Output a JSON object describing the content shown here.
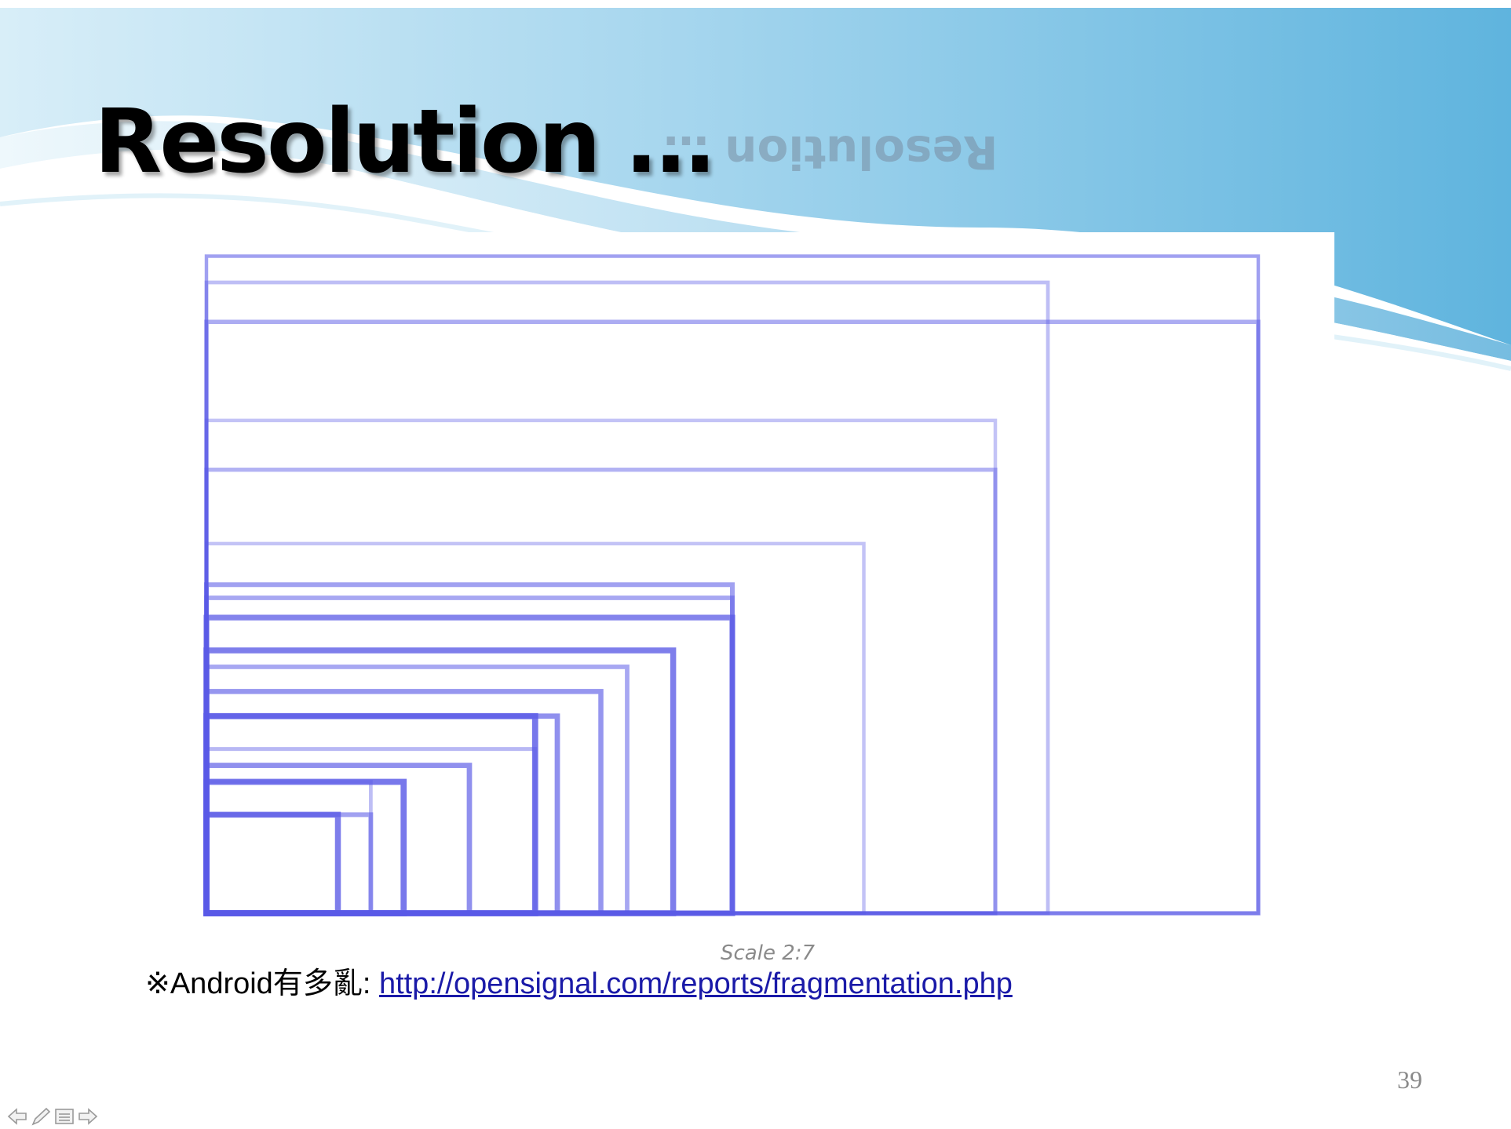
{
  "slide": {
    "title": "Resolution …",
    "title_reflection": "Resolution …",
    "page_number": "39"
  },
  "chart": {
    "scale_label": "Scale 2:7"
  },
  "note": {
    "prefix": "※Android有多亂: ",
    "link_text": "http://opensignal.com/reports/fragmentation.php"
  },
  "nav": {
    "icons": [
      "arrow-left-icon",
      "pen-icon",
      "menu-icon",
      "arrow-right-icon"
    ]
  },
  "colors": {
    "rect_stroke": "#5a5ae6",
    "title_text": "#000000",
    "link": "#1a1aa8",
    "wave_light": "#bfe3f3",
    "wave_dark": "#5cb3dd"
  },
  "chart_data": {
    "type": "resolution-overlay",
    "scale": "2:7",
    "screens": [
      {
        "w": 640,
        "h": 1136,
        "strength": 0.9
      },
      {
        "w": 720,
        "h": 1280,
        "strength": 0.85
      },
      {
        "w": 768,
        "h": 1280,
        "strength": 0.55
      },
      {
        "w": 800,
        "h": 1280,
        "strength": 0.6
      },
      {
        "w": 900,
        "h": 1600,
        "strength": 0.3
      },
      {
        "w": 1080,
        "h": 1920,
        "strength": 0.45
      },
      {
        "w": 1200,
        "h": 1920,
        "strength": 0.3
      },
      {
        "w": 1536,
        "h": 2048,
        "strength": 0.35
      },
      {
        "w": 1600,
        "h": 2560,
        "strength": 0.3
      },
      {
        "w": 480,
        "h": 800,
        "strength": 0.95
      },
      {
        "w": 480,
        "h": 854,
        "strength": 0.75
      },
      {
        "w": 540,
        "h": 960,
        "strength": 0.7
      },
      {
        "w": 600,
        "h": 1024,
        "strength": 0.55
      },
      {
        "w": 320,
        "h": 480,
        "strength": 0.95
      },
      {
        "w": 360,
        "h": 640,
        "strength": 0.75
      },
      {
        "w": 400,
        "h": 800,
        "strength": 0.4
      },
      {
        "w": 240,
        "h": 320,
        "strength": 0.9
      },
      {
        "w": 240,
        "h": 400,
        "strength": 0.6
      },
      {
        "w": 320,
        "h": 400,
        "strength": 0.35
      },
      {
        "w": 1440,
        "h": 2560,
        "strength": 0.5
      },
      {
        "w": 1600,
        "h": 2560,
        "strength": 0.25
      }
    ]
  }
}
